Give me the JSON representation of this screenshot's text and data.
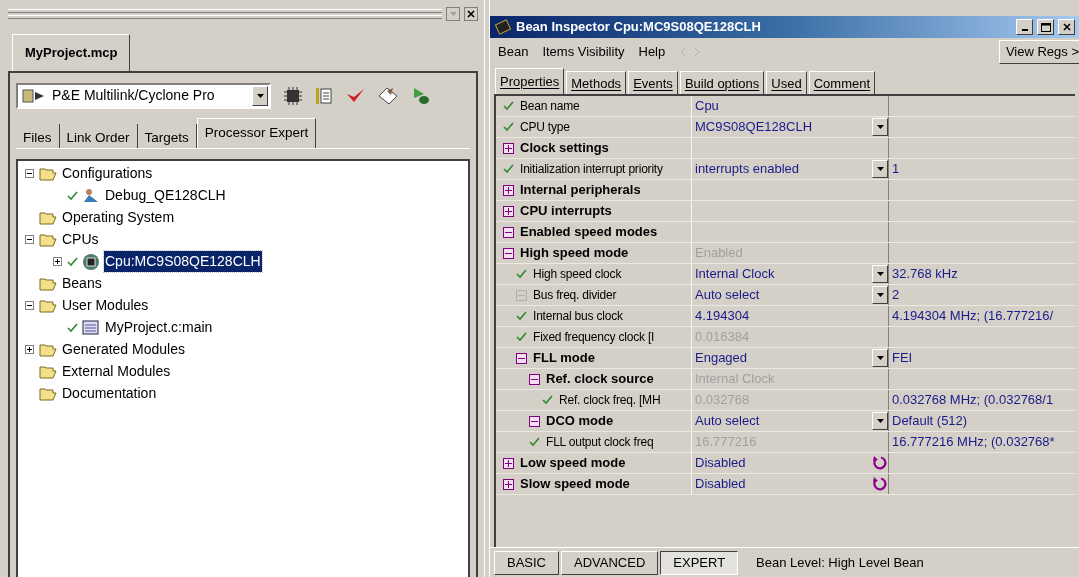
{
  "project_panel": {
    "tab": "MyProject.mcp",
    "target": "P&E Multilink/Cyclone Pro",
    "tabs": [
      {
        "label": "Files",
        "selected": false
      },
      {
        "label": "Link Order",
        "selected": false
      },
      {
        "label": "Targets",
        "selected": false
      },
      {
        "label": "Processor Expert",
        "selected": true
      }
    ],
    "tree": [
      {
        "label": "Configurations",
        "kind": "folder",
        "expanded": true,
        "selected": false,
        "children": [
          {
            "label": "Debug_QE128CLH",
            "kind": "config",
            "checked": true,
            "selected": false
          }
        ]
      },
      {
        "label": "Operating System",
        "kind": "folder",
        "selected": false
      },
      {
        "label": "CPUs",
        "kind": "folder",
        "expanded": true,
        "selected": false,
        "children": [
          {
            "label": "Cpu:MC9S08QE128CLH",
            "kind": "cpu",
            "checked": true,
            "expanded": false,
            "selected": true
          }
        ]
      },
      {
        "label": "Beans",
        "kind": "folder",
        "selected": false
      },
      {
        "label": "User Modules",
        "kind": "folder",
        "expanded": true,
        "selected": false,
        "children": [
          {
            "label": "MyProject.c:main",
            "kind": "module",
            "checked": true,
            "selected": false
          }
        ]
      },
      {
        "label": "Generated Modules",
        "kind": "folder",
        "expanded": false,
        "selected": false
      },
      {
        "label": "External Modules",
        "kind": "folder",
        "selected": false
      },
      {
        "label": "Documentation",
        "kind": "folder",
        "selected": false
      }
    ]
  },
  "inspector": {
    "title": "Bean Inspector Cpu:MC9S08QE128CLH",
    "menu": [
      "Bean",
      "Items Visibility",
      "Help"
    ],
    "view_regs": "View Regs >",
    "tabs": [
      {
        "label": "Properties",
        "selected": true
      },
      {
        "label": "Methods",
        "selected": false
      },
      {
        "label": "Events",
        "selected": false
      },
      {
        "label": "Build options",
        "selected": false
      },
      {
        "label": "Used",
        "selected": false
      },
      {
        "label": "Comment",
        "selected": false
      }
    ],
    "rows": [
      {
        "kind": "check",
        "name": "Bean name",
        "bold": false,
        "value": "Cpu",
        "dropdown": false
      },
      {
        "kind": "check",
        "name": "CPU type",
        "bold": false,
        "value": "MC9S08QE128CLH",
        "dropdown": true
      },
      {
        "kind": "plus",
        "name": "Clock settings",
        "bold": true
      },
      {
        "kind": "check",
        "name": "Initialization interrupt priority",
        "bold": false,
        "value": "interrupts enabled",
        "dropdown": true,
        "extra": "1"
      },
      {
        "kind": "plus",
        "name": "Internal peripherals",
        "bold": true
      },
      {
        "kind": "plus",
        "name": "CPU interrupts",
        "bold": true
      },
      {
        "kind": "minus",
        "name": "Enabled speed modes",
        "bold": true
      },
      {
        "kind": "minus",
        "name": "High speed mode",
        "bold": true,
        "value": "Enabled",
        "disabled": true,
        "children": [
          {
            "kind": "check",
            "name": "High speed clock",
            "bold": false,
            "value": "Internal Clock",
            "dropdown": true,
            "extra": "32.768 kHz"
          },
          {
            "kind": "inactive",
            "name": "Bus freq. divider",
            "bold": false,
            "value": "Auto select",
            "dropdown": true,
            "extra": "2"
          },
          {
            "kind": "check",
            "name": "Internal bus clock",
            "bold": false,
            "value": "4.194304",
            "extra": "4.194304 MHz; (16.777216/"
          },
          {
            "kind": "check",
            "name": "Fixed frequency clock [I",
            "bold": false,
            "value": "0.016384",
            "disabled": true
          },
          {
            "kind": "minus",
            "name": "FLL mode",
            "bold": true,
            "value": "Engaged",
            "dropdown": true,
            "extra": "FEI",
            "children": [
              {
                "kind": "minus",
                "name": "Ref. clock source",
                "bold": true,
                "value": "Internal Clock",
                "disabled": true,
                "children": [
                  {
                    "kind": "check",
                    "name": "Ref. clock freq. [MH",
                    "bold": false,
                    "value": "0.032768",
                    "disabled": true,
                    "extra": "0.032768 MHz; (0.032768/1"
                  }
                ]
              },
              {
                "kind": "minus",
                "name": "DCO mode",
                "bold": true,
                "value": "Auto select",
                "dropdown": true,
                "extra": "Default (512)"
              },
              {
                "kind": "check",
                "name": "FLL output clock freq",
                "bold": false,
                "value": "16.777216",
                "disabled": true,
                "extra": "16.777216 MHz; (0.032768*"
              }
            ]
          }
        ]
      },
      {
        "kind": "plus",
        "name": "Low speed mode",
        "bold": true,
        "value": "Disabled",
        "reset": true
      },
      {
        "kind": "plus",
        "name": "Slow speed mode",
        "bold": true,
        "value": "Disabled",
        "reset": true
      }
    ],
    "levels": [
      {
        "label": "BASIC",
        "selected": false
      },
      {
        "label": "ADVANCED",
        "selected": false
      },
      {
        "label": "EXPERT",
        "selected": true
      }
    ],
    "status": "Bean Level: High Level Bean"
  }
}
